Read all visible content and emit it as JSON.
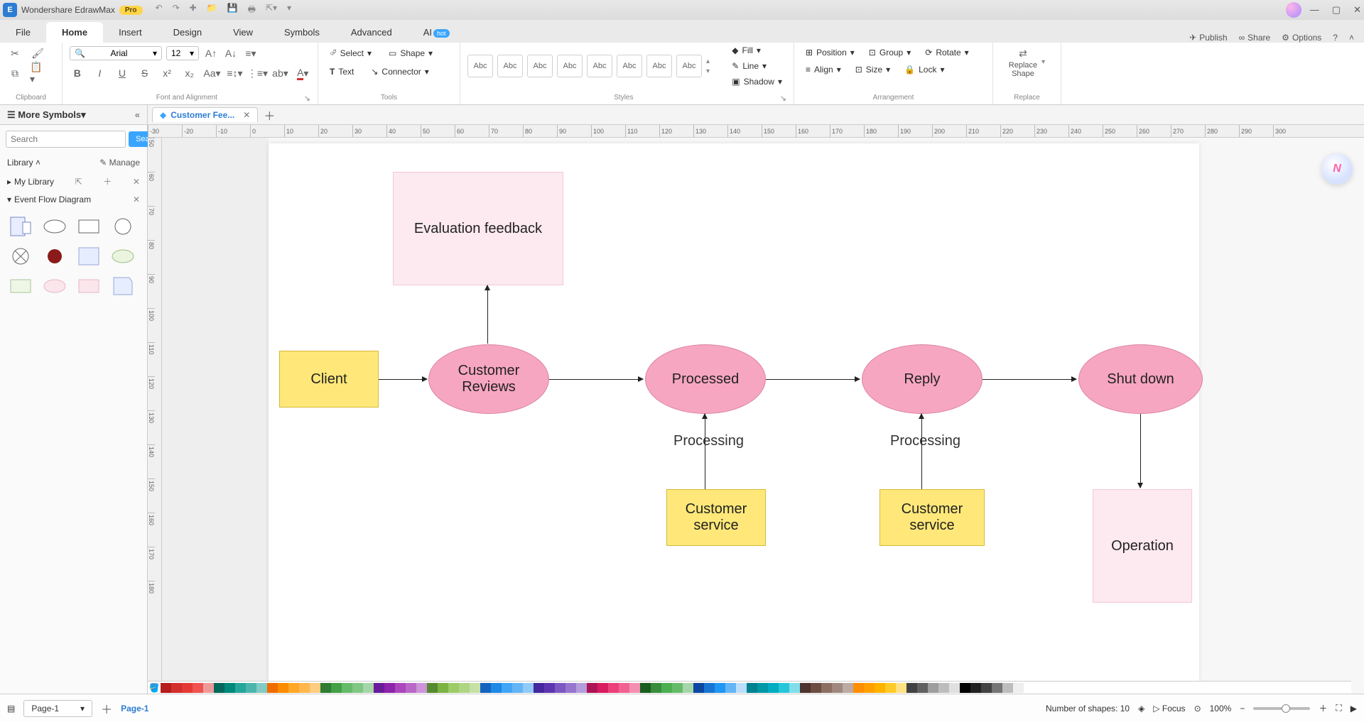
{
  "titlebar": {
    "brand": "Wondershare EdrawMax",
    "pro": "Pro"
  },
  "menu": {
    "tabs": [
      "File",
      "Home",
      "Insert",
      "Design",
      "View",
      "Symbols",
      "Advanced",
      "AI"
    ],
    "active_index": 1,
    "hot": "hot",
    "right": {
      "publish": "Publish",
      "share": "Share",
      "options": "Options"
    }
  },
  "ribbon": {
    "clipboard_label": "Clipboard",
    "font": {
      "name": "Arial",
      "size": "12"
    },
    "font_align_label": "Font and Alignment",
    "tools": {
      "select": "Select",
      "shape": "Shape",
      "text": "Text",
      "connector": "Connector",
      "label": "Tools"
    },
    "styles": {
      "card": "Abc",
      "label": "Styles",
      "fill": "Fill",
      "line": "Line",
      "shadow": "Shadow"
    },
    "arrange": {
      "position": "Position",
      "align": "Align",
      "group": "Group",
      "size": "Size",
      "rotate": "Rotate",
      "lock": "Lock",
      "label": "Arrangement"
    },
    "replace": {
      "line1": "Replace",
      "line2": "Shape",
      "label": "Replace"
    }
  },
  "doctab": {
    "title": "Customer Fee..."
  },
  "sidebar": {
    "title": "More Symbols",
    "search_placeholder": "Search",
    "search_btn": "Search",
    "library_label": "Library",
    "manage": "Manage",
    "mylib": "My Library",
    "category": "Event Flow Diagram"
  },
  "ruler_h": [
    "-30",
    "-20",
    "-10",
    "0",
    "10",
    "20",
    "30",
    "40",
    "50",
    "60",
    "70",
    "80",
    "90",
    "100",
    "110",
    "120",
    "130",
    "140",
    "150",
    "160",
    "170",
    "180",
    "190",
    "200",
    "210",
    "220",
    "230",
    "240",
    "250",
    "260",
    "270",
    "280",
    "290",
    "300"
  ],
  "ruler_v": [
    "50",
    "60",
    "70",
    "80",
    "90",
    "100",
    "110",
    "120",
    "130",
    "140",
    "150",
    "160",
    "170",
    "180"
  ],
  "diagram": {
    "eval": "Evaluation feedback",
    "client": "Client",
    "reviews": "Customer\nReviews",
    "processed": "Processed",
    "reply": "Reply",
    "shutdown": "Shut down",
    "processing1": "Processing",
    "processing2": "Processing",
    "cs1": "Customer\nservice",
    "cs2": "Customer\nservice",
    "operation": "Operation"
  },
  "colors": [
    "#b71c1c",
    "#d32f2f",
    "#e53935",
    "#ef5350",
    "#ef9a9a",
    "#00695c",
    "#00897b",
    "#26a69a",
    "#4db6ac",
    "#80cbc4",
    "#ef6c00",
    "#fb8c00",
    "#ffa726",
    "#ffb74d",
    "#ffcc80",
    "#2e7d32",
    "#43a047",
    "#66bb6a",
    "#81c784",
    "#a5d6a7",
    "#6a1b9a",
    "#8e24aa",
    "#ab47bc",
    "#ba68c8",
    "#ce93d8",
    "#558b2f",
    "#7cb342",
    "#9ccc65",
    "#aed581",
    "#c5e1a5",
    "#1565c0",
    "#1e88e5",
    "#42a5f5",
    "#64b5f6",
    "#90caf9",
    "#4527a0",
    "#5e35b1",
    "#7e57c2",
    "#9575cd",
    "#b39ddb",
    "#ad1457",
    "#d81b60",
    "#ec407a",
    "#f06292",
    "#f48fb1",
    "#1b5e20",
    "#388e3c",
    "#4caf50",
    "#66bb6a",
    "#a5d6a7",
    "#0d47a1",
    "#1976d2",
    "#2196f3",
    "#64b5f6",
    "#bbdefb",
    "#00838f",
    "#0097a7",
    "#00acc1",
    "#26c6da",
    "#80deea",
    "#4e342e",
    "#6d4c41",
    "#8d6e63",
    "#a1887f",
    "#bcaaa4",
    "#ff8f00",
    "#ffa000",
    "#ffb300",
    "#ffca28",
    "#ffe082",
    "#424242",
    "#616161",
    "#9e9e9e",
    "#bdbdbd",
    "#e0e0e0",
    "#000000",
    "#212121",
    "#424242",
    "#757575",
    "#bdbdbd",
    "#eeeeee",
    "#ffffff"
  ],
  "status": {
    "page_sel": "Page-1",
    "page_tab": "Page-1",
    "shapes": "Number of shapes: 10",
    "focus": "Focus",
    "zoom": "100%"
  }
}
